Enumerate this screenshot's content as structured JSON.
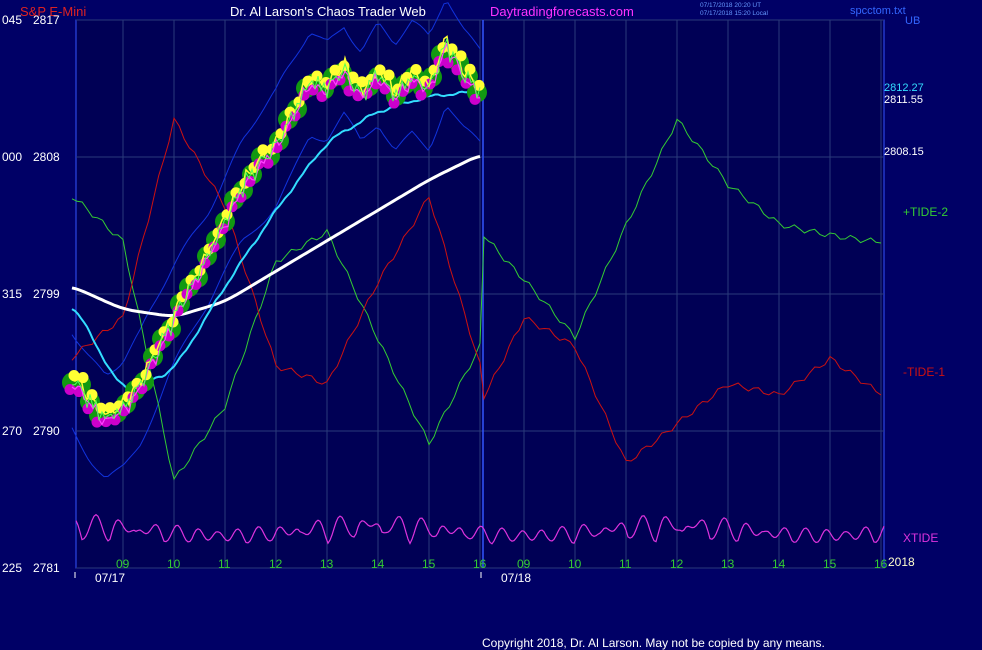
{
  "header": {
    "symbol": "S&P E-Mini",
    "site_title": "Dr. Al Larson's Chaos Trader Web",
    "site_link": "Daytradingforecasts.com",
    "timestamp_ut": "07/17/2018 20:20 UT",
    "timestamp_local": "07/17/2018 15:20 Local",
    "corner_link": "spcctom.txt",
    "corner_code": "UB"
  },
  "copyright": "Copyright 2018, Dr. Al Larson. May not be copied by any means.",
  "colors": {
    "background": "#000066",
    "plot_background": "#000044",
    "grid": "#2a3a7a",
    "price_yellow": "#ffff33",
    "price_magenta": "#cc00cc",
    "price_green_halo": "#119911",
    "ma_cyan": "#33ddff",
    "ma_white": "#ffffff",
    "band_blue": "#1133dd",
    "tide_plus": "#33cc33",
    "tide_minus": "#cc1111",
    "xtide": "#dd33dd",
    "axis_text": "#ffffff",
    "hour_text": "#33cc33"
  },
  "chart_data": {
    "type": "line",
    "title": "S&P E-Mini",
    "y_axis": {
      "range": [
        2781,
        2817
      ],
      "ticks": [
        {
          "left": "045",
          "value": "2817"
        },
        {
          "left": "000",
          "value": "2808"
        },
        {
          "left": "315",
          "value": "2799"
        },
        {
          "left": "270",
          "value": "2790"
        },
        {
          "left": "225",
          "value": "2781"
        }
      ]
    },
    "x_axis": {
      "hour_ticks": [
        "09",
        "10",
        "11",
        "12",
        "13",
        "14",
        "15",
        "16",
        "09",
        "10",
        "11",
        "12",
        "13",
        "14",
        "15",
        "16"
      ],
      "dates": [
        "07/17",
        "07/18"
      ],
      "year_label": "2018",
      "session_split": "07/18 09:00"
    },
    "right_labels": {
      "last_price_cyan": "2812.27",
      "last_price_white": "2811.55",
      "ma_slow": "2808.15",
      "tide_plus": "+TIDE-2",
      "tide_minus": "-TIDE-1",
      "xtide": "XTIDE"
    },
    "series": [
      {
        "name": "Price",
        "x": [
          "07/17 08:00",
          "07/17 08:20",
          "07/17 08:40",
          "07/17 09:00",
          "07/17 09:20",
          "07/17 09:40",
          "07/17 10:00",
          "07/17 10:20",
          "07/17 10:40",
          "07/17 11:00",
          "07/17 11:20",
          "07/17 11:40",
          "07/17 12:00",
          "07/17 12:20",
          "07/17 12:40",
          "07/17 13:00",
          "07/17 13:20",
          "07/17 13:40",
          "07/17 14:00",
          "07/17 14:20",
          "07/17 14:40",
          "07/17 15:00",
          "07/17 15:20",
          "07/17 15:40",
          "07/17 16:00"
        ],
        "values": [
          2793.5,
          2792.0,
          2790.8,
          2791.5,
          2793.0,
          2795.2,
          2797.5,
          2799.5,
          2801.5,
          2803.8,
          2806.0,
          2807.5,
          2808.8,
          2810.8,
          2813.0,
          2812.5,
          2813.8,
          2812.0,
          2813.5,
          2812.0,
          2813.3,
          2812.5,
          2815.5,
          2813.5,
          2812.3
        ]
      },
      {
        "name": "MA fast",
        "x": [
          "07/17 08:00",
          "07/17 09:00",
          "07/17 10:00",
          "07/17 11:00",
          "07/17 12:00",
          "07/17 13:00",
          "07/17 14:00",
          "07/17 15:00",
          "07/17 16:00"
        ],
        "values": [
          2798.5,
          2792.5,
          2794.0,
          2799.5,
          2804.5,
          2809.0,
          2811.0,
          2812.0,
          2812.3
        ]
      },
      {
        "name": "MA slow",
        "x": [
          "07/17 08:00",
          "07/17 09:00",
          "07/17 10:00",
          "07/17 11:00",
          "07/17 12:00",
          "07/17 13:00",
          "07/17 14:00",
          "07/17 15:00",
          "07/17 16:00"
        ],
        "values": [
          2799.5,
          2798.0,
          2797.5,
          2798.5,
          2800.5,
          2802.5,
          2804.5,
          2806.5,
          2808.15
        ]
      },
      {
        "name": "+TIDE-2",
        "x": [
          "07/17 08:00",
          "07/17 09:00",
          "07/17 10:00",
          "07/17 11:00",
          "07/17 12:00",
          "07/17 13:00",
          "07/17 14:00",
          "07/17 15:00",
          "07/17 16:00",
          "07/17 16:05",
          "07/18 09:00",
          "07/18 10:00",
          "07/18 11:00",
          "07/18 12:00",
          "07/18 13:00",
          "07/18 14:00",
          "07/18 15:00",
          "07/18 16:00"
        ],
        "values": [
          0.55,
          0.3,
          -0.95,
          -0.55,
          0.2,
          0.35,
          -0.2,
          -0.75,
          -0.25,
          0.35,
          0.1,
          -0.2,
          0.4,
          0.95,
          0.6,
          0.4,
          0.35,
          0.3
        ]
      },
      {
        "name": "-TIDE-1",
        "x": [
          "07/17 08:00",
          "07/17 09:00",
          "07/17 10:00",
          "07/17 11:00",
          "07/17 12:00",
          "07/17 13:00",
          "07/17 14:00",
          "07/17 15:00",
          "07/17 16:00",
          "07/17 16:05",
          "07/18 09:00",
          "07/18 10:00",
          "07/18 11:00",
          "07/18 12:00",
          "07/18 13:00",
          "07/18 14:00",
          "07/18 15:00",
          "07/18 16:00"
        ],
        "values": [
          -0.3,
          -0.1,
          0.95,
          0.5,
          -0.35,
          -0.45,
          0.1,
          0.55,
          -0.35,
          -0.5,
          -0.1,
          -0.25,
          -0.85,
          -0.65,
          -0.45,
          -0.5,
          -0.3,
          -0.5
        ]
      },
      {
        "name": "XTIDE",
        "x": [
          "07/17 08:00",
          "07/17 16:00",
          "07/18 09:00",
          "07/18 16:00"
        ],
        "values": [
          0.3,
          0.5,
          0.2,
          0.4
        ]
      }
    ]
  }
}
